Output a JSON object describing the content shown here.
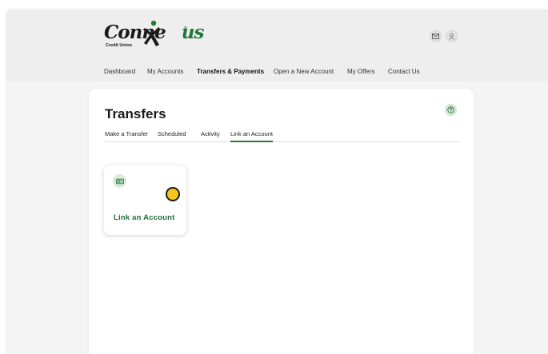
{
  "brand": {
    "name_part1": "Conne",
    "name_part2": "us",
    "subtitle": "Credit Union",
    "trademark": "®",
    "accent_color": "#1f7a3a"
  },
  "header": {
    "icons": [
      "mail-icon",
      "user-icon"
    ]
  },
  "nav": {
    "items": [
      {
        "label": "Dashboard"
      },
      {
        "label": "My Accounts"
      },
      {
        "label": "Transfers & Payments",
        "active": true
      },
      {
        "label": "Open a New Account"
      },
      {
        "label": "My Offers"
      },
      {
        "label": "Contact Us"
      }
    ]
  },
  "main": {
    "title": "Transfers",
    "help_icon": "question-icon",
    "tabs": [
      {
        "label": "Make a Transfer"
      },
      {
        "label": "Scheduled"
      },
      {
        "label": "Activity"
      },
      {
        "label": "Link an Account",
        "active": true
      }
    ],
    "link_card": {
      "icon": "link-account-icon",
      "label": "Link an Account"
    }
  }
}
